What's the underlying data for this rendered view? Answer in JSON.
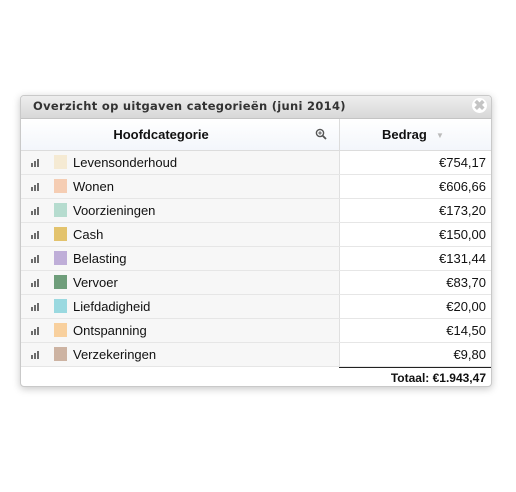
{
  "dialog": {
    "title": "Overzicht op uitgaven categorieën (juni 2014)",
    "close_glyph": "✖"
  },
  "table": {
    "headers": {
      "category": "Hoofdcategorie",
      "amount": "Bedrag",
      "sort_glyph": "▼",
      "zoom_icon": "magnifier-icon"
    },
    "rows": [
      {
        "name": "Levensonderhoud",
        "amount": "€754,17",
        "color": "#f5ead3"
      },
      {
        "name": "Wonen",
        "amount": "€606,66",
        "color": "#f5cdb3"
      },
      {
        "name": "Voorzieningen",
        "amount": "€173,20",
        "color": "#b6dccf"
      },
      {
        "name": "Cash",
        "amount": "€150,00",
        "color": "#e3c36d"
      },
      {
        "name": "Belasting",
        "amount": "€131,44",
        "color": "#bfaed8"
      },
      {
        "name": "Vervoer",
        "amount": "€83,70",
        "color": "#6f9e7b"
      },
      {
        "name": "Liefdadigheid",
        "amount": "€20,00",
        "color": "#9ad9e0"
      },
      {
        "name": "Ontspanning",
        "amount": "€14,50",
        "color": "#f8d09e"
      },
      {
        "name": "Verzekeringen",
        "amount": "€9,80",
        "color": "#cdb3a2"
      }
    ],
    "row_icon": "bar-chart-icon",
    "total": "Totaal: €1.943,47"
  }
}
